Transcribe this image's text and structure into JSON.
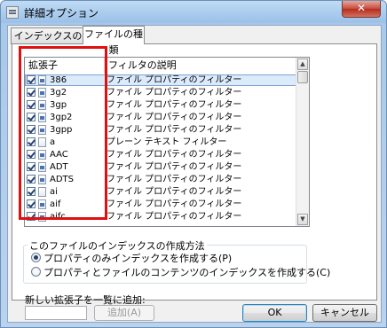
{
  "window": {
    "title": "詳細オプション",
    "close_glyph": "✕"
  },
  "tabs": [
    {
      "label": "インデックスの設定",
      "active": false
    },
    {
      "label": "ファイルの種類",
      "active": true
    }
  ],
  "list": {
    "col_ext": "拡張子",
    "col_desc": "フィルタの説明",
    "rows": [
      {
        "ext": "386",
        "desc": "ファイル プロパティのフィルター",
        "checked": true,
        "icon": "property-file-icon",
        "selected": true
      },
      {
        "ext": "3g2",
        "desc": "ファイル プロパティのフィルター",
        "checked": true,
        "icon": "property-file-icon",
        "selected": false
      },
      {
        "ext": "3gp",
        "desc": "ファイル プロパティのフィルター",
        "checked": true,
        "icon": "property-file-icon",
        "selected": false
      },
      {
        "ext": "3gp2",
        "desc": "ファイル プロパティのフィルター",
        "checked": true,
        "icon": "property-file-icon",
        "selected": false
      },
      {
        "ext": "3gpp",
        "desc": "ファイル プロパティのフィルター",
        "checked": true,
        "icon": "property-file-icon",
        "selected": false
      },
      {
        "ext": "a",
        "desc": "プレーン テキスト フィルター",
        "checked": true,
        "icon": "text-file-icon",
        "selected": false
      },
      {
        "ext": "AAC",
        "desc": "ファイル プロパティのフィルター",
        "checked": true,
        "icon": "property-file-icon",
        "selected": false
      },
      {
        "ext": "ADT",
        "desc": "ファイル プロパティのフィルター",
        "checked": true,
        "icon": "property-file-icon",
        "selected": false
      },
      {
        "ext": "ADTS",
        "desc": "ファイル プロパティのフィルター",
        "checked": true,
        "icon": "property-file-icon",
        "selected": false
      },
      {
        "ext": "ai",
        "desc": "ファイル プロパティのフィルター",
        "checked": true,
        "icon": "text-file-icon",
        "selected": false
      },
      {
        "ext": "aif",
        "desc": "ファイル プロパティのフィルター",
        "checked": true,
        "icon": "property-file-icon",
        "selected": false
      },
      {
        "ext": "aifc",
        "desc": "ファイル プロパティのフィルター",
        "checked": true,
        "icon": "property-file-icon",
        "selected": false
      }
    ]
  },
  "index_method": {
    "label": "このファイルのインデックスの作成方法",
    "option_properties": "プロパティのみインデックスを作成する(P)",
    "option_contents": "プロパティとファイルのコンテンツのインデックスを作成する(C)",
    "selected": "properties"
  },
  "add_extension": {
    "label": "新しい拡張子を一覧に追加:",
    "value": "",
    "button": "追加(A)"
  },
  "buttons": {
    "ok": "OK",
    "cancel": "キャンセル"
  },
  "colors": {
    "highlight_box": "#e01010",
    "title_bar": "#9cc1e8",
    "close_button": "#c6493a"
  }
}
